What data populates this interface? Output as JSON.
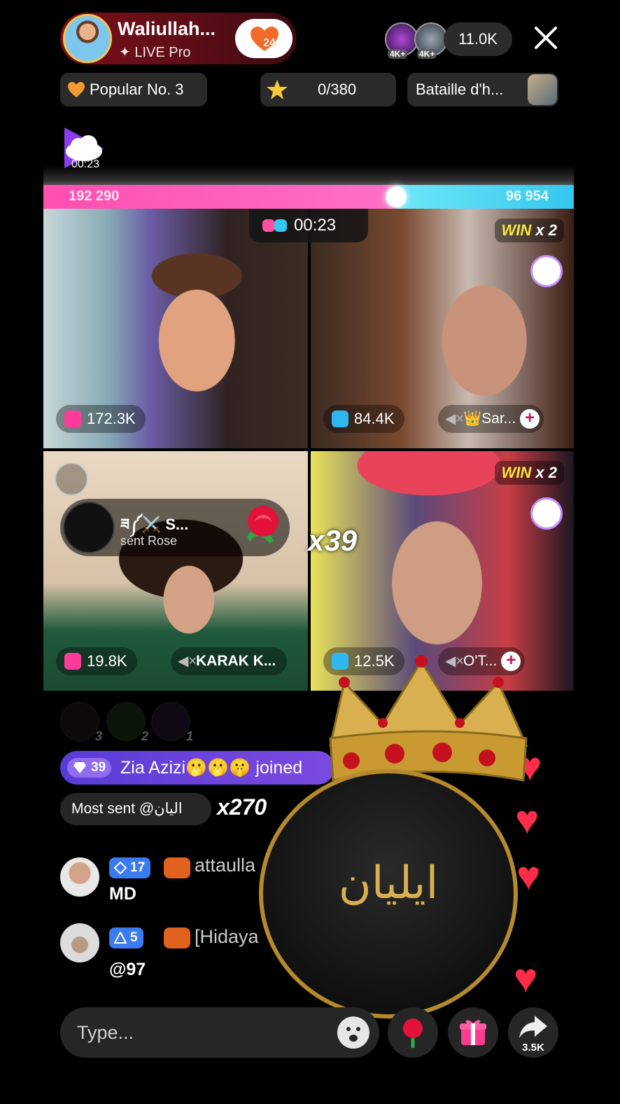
{
  "host": {
    "name": "Waliullah...",
    "subtitle": "✦ LIVE Pro",
    "follow_count": "24"
  },
  "viewers": {
    "badges": [
      "4K+",
      "4K+"
    ],
    "count": "11.0K"
  },
  "chips": {
    "popular": "Popular No. 3",
    "star_progress": "0/380",
    "battle": "Bataille d'h..."
  },
  "battle": {
    "cloud_timer": "00:23",
    "left_score": "192 290",
    "right_score": "96 954",
    "left_share": 0.665,
    "timer": "00:23",
    "combo": "x39"
  },
  "tiles": [
    {
      "stat": "172.3K",
      "stat_color": "#ff3b9a"
    },
    {
      "stat": "84.4K",
      "stat_color": "#2fb7f0",
      "guest": "👑Sar...",
      "win": "WIN",
      "win_mult": "x 2"
    },
    {
      "stat": "19.8K",
      "stat_color": "#ff3b9a",
      "guest": "KARAK K..."
    },
    {
      "stat": "12.5K",
      "stat_color": "#2fb7f0",
      "guest": "O'T...",
      "win": "WIN",
      "win_mult": "x 2"
    }
  ],
  "gift_banner": {
    "name": "ཟ༼⚔️ S...",
    "action": "sent Rose"
  },
  "ranks": [
    "3",
    "2",
    "1"
  ],
  "join": {
    "level": "39",
    "text": "Zia Azizi🫢🫢🤫 joined"
  },
  "most_sent": {
    "label": "Most sent @اليان",
    "count": "x270"
  },
  "chat": [
    {
      "level": "17",
      "user": "attaulla",
      "message": "MD",
      "badge_color": "#3b7bf0"
    },
    {
      "level": "5",
      "user": "[Hidaya",
      "message": "@97",
      "badge_color": "#3b7bf0"
    }
  ],
  "medallion_text": "ايليان",
  "input": {
    "placeholder": "Type..."
  },
  "share_count": "3.5K",
  "colors": {
    "pink": "#ff4fb0",
    "cyan": "#35c7ef",
    "host_pill": "#7a0f1a",
    "heart": "#ff2d4a"
  }
}
